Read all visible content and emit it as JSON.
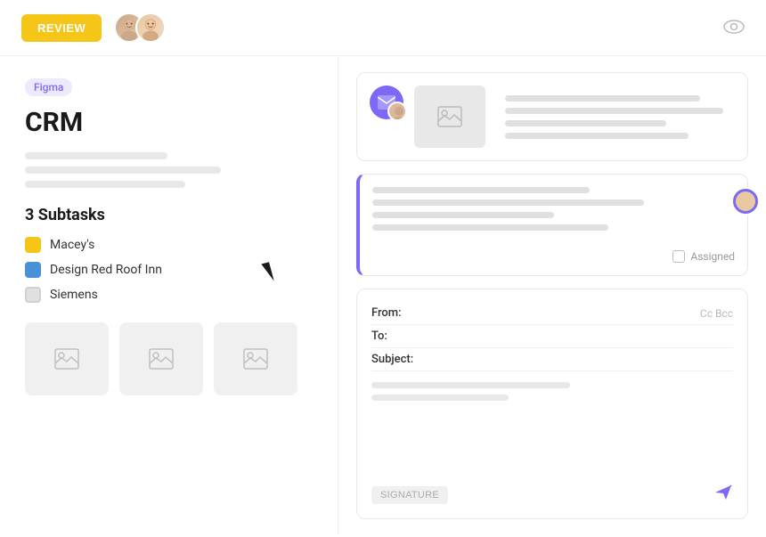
{
  "header": {
    "review_button": "REVIEW",
    "eye_icon": "👁"
  },
  "left_panel": {
    "figma_badge": "Figma",
    "project_title": "CRM",
    "subtasks_title": "3 Subtasks",
    "subtasks": [
      {
        "label": "Macey's",
        "dot_type": "yellow"
      },
      {
        "label": "Design Red Roof Inn",
        "dot_type": "blue"
      },
      {
        "label": "Siemens",
        "dot_type": "gray"
      }
    ]
  },
  "right_panel": {
    "assigned_label": "Assigned",
    "email": {
      "from_label": "From:",
      "to_label": "To:",
      "subject_label": "Subject:",
      "cc_bcc": "Cc Bcc",
      "signature_btn": "SIGNATURE"
    }
  }
}
